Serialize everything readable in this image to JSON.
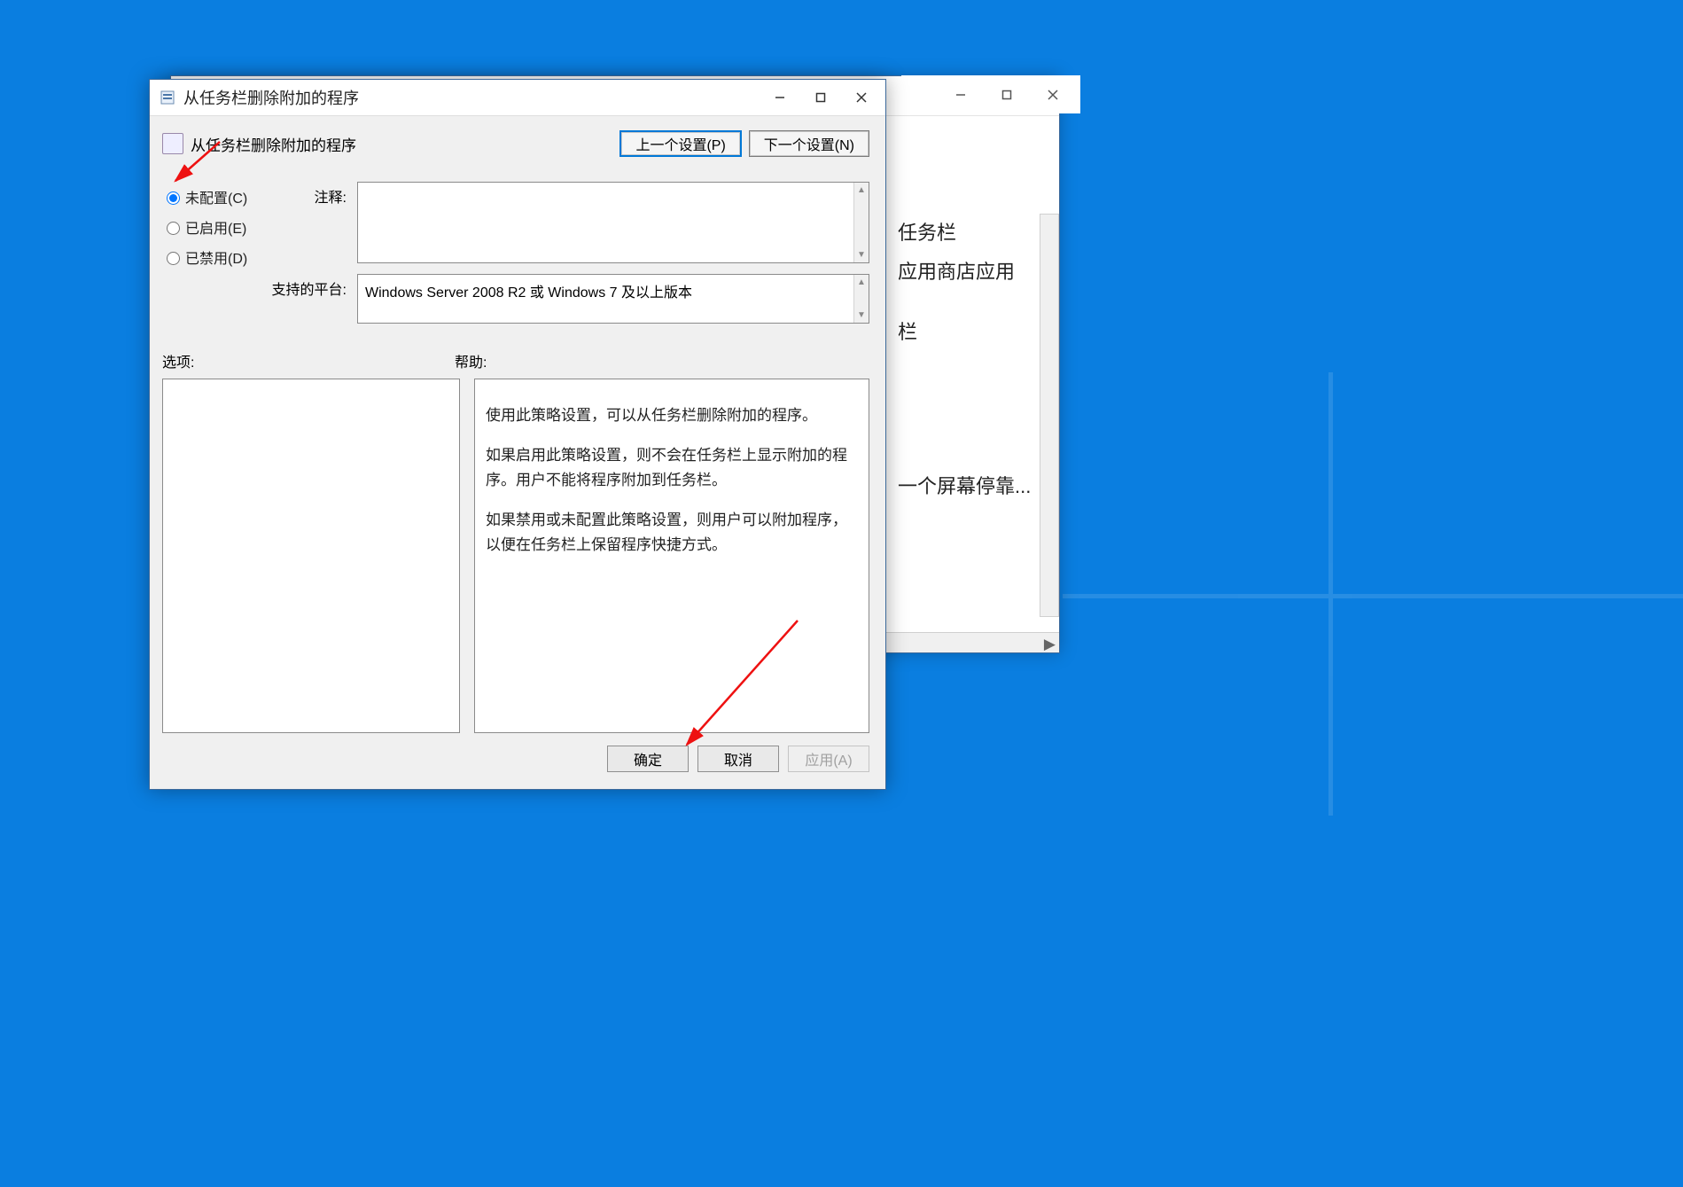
{
  "dialog": {
    "title": "从任务栏删除附加的程序",
    "policy_name": "从任务栏删除附加的程序",
    "nav_prev": "上一个设置(P)",
    "nav_next": "下一个设置(N)",
    "radio_not_configured": "未配置(C)",
    "radio_enabled": "已启用(E)",
    "radio_disabled": "已禁用(D)",
    "comment_label": "注释:",
    "supported_label": "支持的平台:",
    "supported_text": "Windows Server 2008 R2 或 Windows 7 及以上版本",
    "options_label": "选项:",
    "help_label": "帮助:",
    "help_text_1": "使用此策略设置，可以从任务栏删除附加的程序。",
    "help_text_2": "如果启用此策略设置，则不会在任务栏上显示附加的程序。用户不能将程序附加到任务栏。",
    "help_text_3": "如果禁用或未配置此策略设置，则用户可以附加程序，以便在任务栏上保留程序快捷方式。",
    "btn_ok": "确定",
    "btn_cancel": "取消",
    "btn_apply": "应用(A)"
  },
  "back_window": {
    "item1": "任务栏",
    "item2": "应用商店应用",
    "item3": "栏",
    "item4": "一个屏幕停靠..."
  }
}
